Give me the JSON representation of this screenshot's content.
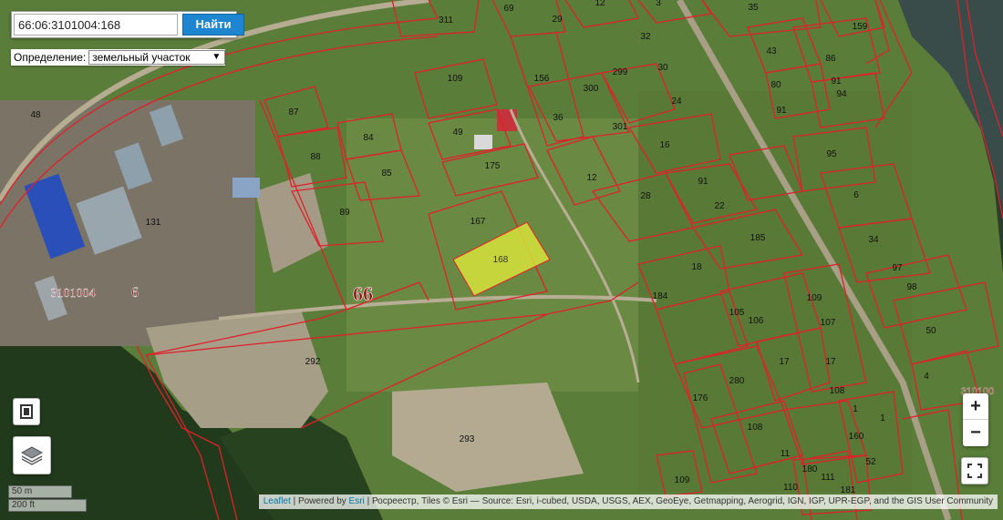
{
  "search": {
    "value": "66:06:3101004:168",
    "button_label": "Найти"
  },
  "definition": {
    "label": "Определение:",
    "selected": "земельный участок"
  },
  "map": {
    "selected_parcel": {
      "number": "168",
      "color": "#d6e23a"
    },
    "region_label": "66",
    "quarter_labels": [
      "3101004",
      "6",
      "310100"
    ],
    "parcel_numbers": [
      "311",
      "69",
      "29",
      "12",
      "3",
      "35",
      "159",
      "32",
      "48",
      "109",
      "156",
      "300",
      "299",
      "30",
      "43",
      "86",
      "80",
      "91",
      "94",
      "24",
      "49",
      "36",
      "301",
      "91",
      "87",
      "84",
      "88",
      "85",
      "175",
      "16",
      "12",
      "95",
      "6",
      "91",
      "22",
      "28",
      "167",
      "89",
      "131",
      "185",
      "34",
      "18",
      "97",
      "98",
      "184",
      "105",
      "106",
      "109",
      "107",
      "50",
      "292",
      "280",
      "17",
      "17",
      "4",
      "176",
      "108",
      "1",
      "108",
      "160",
      "11",
      "52",
      "180",
      "111",
      "109",
      "293",
      "110",
      "181",
      "1"
    ],
    "line_color": "#e0202a"
  },
  "zoom": {
    "in_label": "+",
    "out_label": "−"
  },
  "scale": {
    "metric": "50 m",
    "imperial": "200 ft"
  },
  "attribution": {
    "leaflet": "Leaflet",
    "powered_by": "Powered by",
    "esri": "Esri",
    "rest": "Росреестр, Tiles © Esri — Source: Esri, i-cubed, USDA, USGS, AEX, GeoEye, Getmapping, Aerogrid, IGN, IGP, UPR-EGP, and the GIS User Community"
  }
}
